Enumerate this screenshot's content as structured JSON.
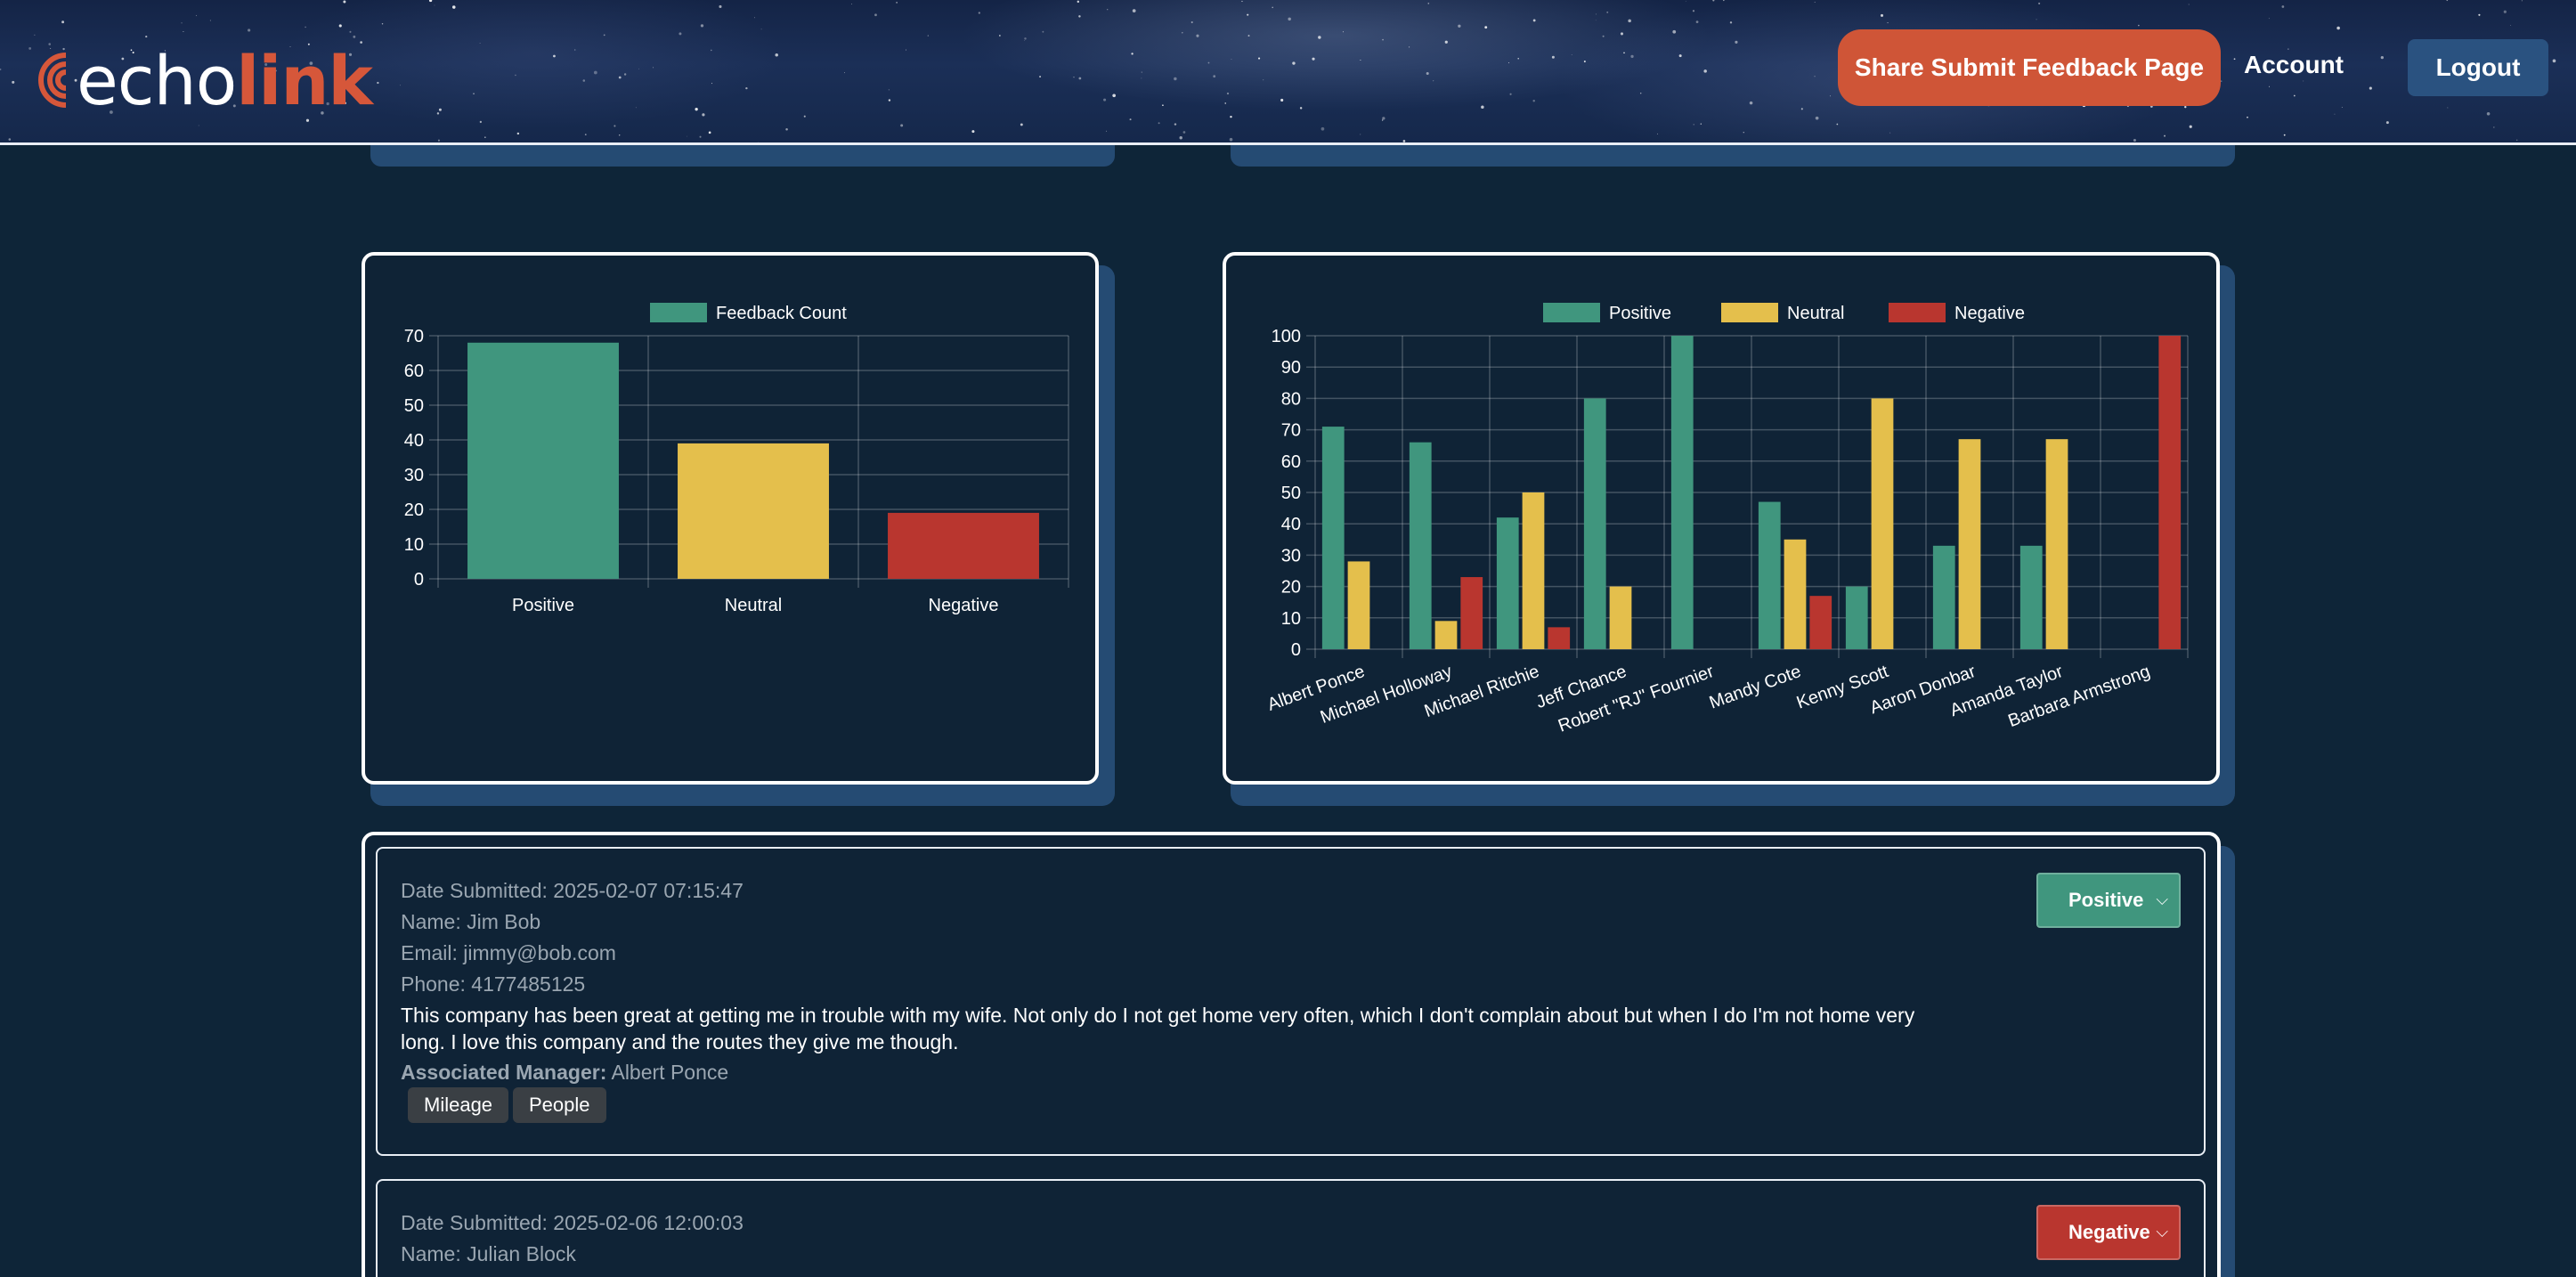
{
  "header": {
    "logo_echo": "echo",
    "logo_link": "link",
    "share_button": "Share Submit Feedback Page",
    "account_link": "Account",
    "logout_button": "Logout"
  },
  "colors": {
    "positive": "#40967e",
    "neutral": "#e4bf4c",
    "negative": "#b9362f",
    "accent": "#cf5537",
    "panel": "#0f2336",
    "card_shadow": "#254b73"
  },
  "chart_data": [
    {
      "type": "bar",
      "categories": [
        "Positive",
        "Neutral",
        "Negative"
      ],
      "series": [
        {
          "name": "Feedback Count",
          "values": [
            68,
            39,
            19
          ]
        }
      ],
      "bar_colors": [
        "#40967e",
        "#e4bf4c",
        "#b9362f"
      ],
      "yticks": [
        "0",
        "10",
        "20",
        "30",
        "40",
        "50",
        "60",
        "70"
      ],
      "ylim": [
        0,
        70
      ],
      "grid": true,
      "legend": "top"
    },
    {
      "type": "bar",
      "categories": [
        "Albert Ponce",
        "Michael Holloway",
        "Michael Ritchie",
        "Jeff Chance",
        "Robert \"RJ\" Fournier",
        "Mandy Cote",
        "Kenny Scott",
        "Aaron Donbar",
        "Amanda Taylor",
        "Barbara Armstrong"
      ],
      "series": [
        {
          "name": "Positive",
          "values": [
            71,
            66,
            42,
            80,
            100,
            47,
            20,
            33,
            33,
            0
          ],
          "color": "#40967e"
        },
        {
          "name": "Neutral",
          "values": [
            28,
            9,
            50,
            20,
            0,
            35,
            80,
            67,
            67,
            0
          ],
          "color": "#e4bf4c"
        },
        {
          "name": "Negative",
          "values": [
            0,
            23,
            7,
            0,
            0,
            17,
            0,
            0,
            0,
            100
          ],
          "color": "#b9362f"
        }
      ],
      "yticks": [
        "0",
        "10",
        "20",
        "30",
        "40",
        "50",
        "60",
        "70",
        "80",
        "90",
        "100"
      ],
      "ylim": [
        0,
        100
      ],
      "grid": true,
      "legend": "top"
    }
  ],
  "feedback": [
    {
      "date": "Date Submitted: 2025-02-07 07:15:47",
      "name": "Name: Jim Bob",
      "email": "Email: jimmy@bob.com",
      "phone": "Phone: 4177485125",
      "text": "This company has been great at getting me in trouble with my wife. Not only do I not get home very often, which I don't complain about but when I do I'm not home very long. I love this company and the routes they give me though.",
      "manager_label": "Associated Manager:",
      "manager": " Albert Ponce",
      "tags": [
        "Mileage",
        "People"
      ],
      "sentiment": "Positive",
      "sentiment_color": "#40967e"
    },
    {
      "date": "Date Submitted: 2025-02-06 12:00:03",
      "name": "Name: Julian Block",
      "sentiment": "Negative",
      "sentiment_color": "#b9362f"
    }
  ]
}
